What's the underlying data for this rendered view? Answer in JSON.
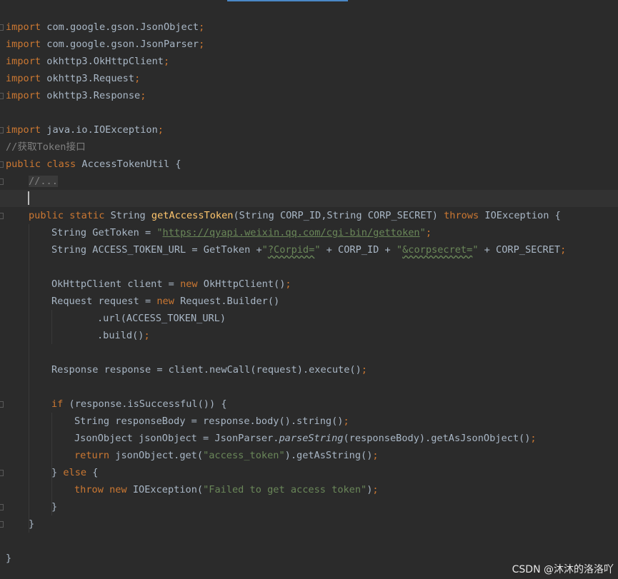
{
  "watermark": "CSDN @沐沐的洛洛吖",
  "code": {
    "l1": {
      "kw": "import",
      "rest": " com.google.gson.JsonObject",
      "semi": ";"
    },
    "l2": {
      "kw": "import",
      "rest": " com.google.gson.JsonParser",
      "semi": ";"
    },
    "l3": {
      "kw": "import",
      "rest": " okhttp3.OkHttpClient",
      "semi": ";"
    },
    "l4": {
      "kw": "import",
      "rest": " okhttp3.Request",
      "semi": ";"
    },
    "l5": {
      "kw": "import",
      "rest": " okhttp3.Response",
      "semi": ";"
    },
    "l7": {
      "kw": "import",
      "rest": " java.io.IOException",
      "semi": ";"
    },
    "l8": {
      "comment": "//获取Token接口"
    },
    "l9": {
      "kw1": "public",
      "kw2": " class",
      "rest": " AccessTokenUtil {"
    },
    "l10": {
      "comment": "//..."
    },
    "l12": {
      "kw1": "public",
      "kw2": " static",
      "t1": " String ",
      "fn": "getAccessToken",
      "t2": "(String CORP_ID,String CORP_SECRET) ",
      "kw3": "throws",
      "t3": " IOException {"
    },
    "l13": {
      "t1": "String GetToken = ",
      "q1": "\"",
      "url": "https://qyapi.weixin.qq.com/cgi-bin/gettoken",
      "q2": "\"",
      "semi": ";"
    },
    "l14": {
      "t1": "String ACCESS_TOKEN_URL = GetToken +",
      "s1a": "\"",
      "s1b": "?Corpid=",
      "s1c": "\"",
      "t2": " + CORP_ID + ",
      "s2a": "\"",
      "s2b": "&corpsecret=",
      "s2c": "\"",
      "t3": " + CORP_SECRET",
      "semi": ";"
    },
    "l16": {
      "t1": "OkHttpClient client = ",
      "kw": "new",
      "t2": " OkHttpClient()",
      "semi": ";"
    },
    "l17": {
      "t1": "Request request = ",
      "kw": "new",
      "t2": " Request.Builder()"
    },
    "l18": {
      "t1": ".url(ACCESS_TOKEN_URL)"
    },
    "l19": {
      "t1": ".build()",
      "semi": ";"
    },
    "l21": {
      "t1": "Response response = client.newCall(request).execute()",
      "semi": ";"
    },
    "l23": {
      "kw": "if",
      "t1": " (response.isSuccessful()) {"
    },
    "l24": {
      "t1": "String responseBody = response.body().string()",
      "semi": ";"
    },
    "l25": {
      "t1": "JsonObject jsonObject = JsonParser.",
      "it": "parseString",
      "t2": "(responseBody).getAsJsonObject()",
      "semi": ";"
    },
    "l26": {
      "kw": "return",
      "t1": " jsonObject.get(",
      "str": "\"access_token\"",
      "t2": ").getAsString()",
      "semi": ";"
    },
    "l27": {
      "t1": "} ",
      "kw": "else",
      "t2": " {"
    },
    "l28": {
      "kw1": "throw",
      "kw2": " new",
      "t1": " IOException(",
      "str": "\"Failed to get access token\"",
      "t2": ")",
      "semi": ";"
    },
    "l29": {
      "t1": "}"
    },
    "l30": {
      "t1": "}"
    },
    "l32": {
      "t1": "}"
    }
  }
}
